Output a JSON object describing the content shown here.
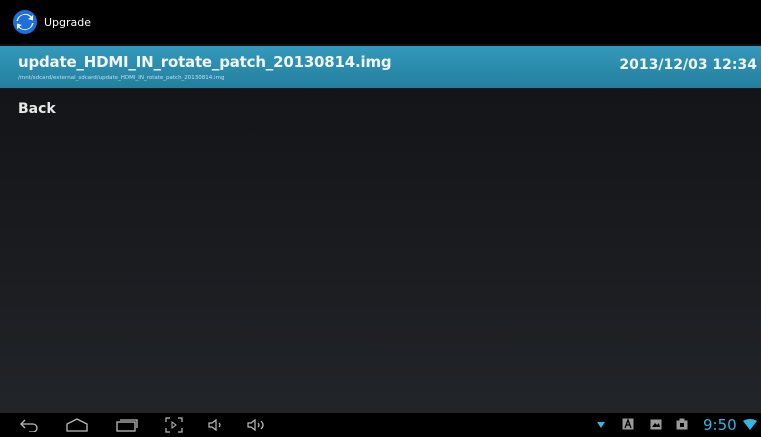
{
  "app": {
    "title": "Upgrade",
    "icon": "upgrade-sync-icon"
  },
  "file_list": {
    "items": [
      {
        "name": "update_HDMI_IN_rotate_patch_20130814.img",
        "path": "/mnt/sdcard/external_sdcard/update_HDMI_IN_rotate_patch_20130814.img",
        "date": "2013/12/03 12:34",
        "selected": true
      }
    ],
    "back_label": "Back"
  },
  "nav_bar": {
    "buttons": [
      "back-icon",
      "home-icon",
      "recent-apps-icon",
      "screenshot-icon",
      "volume-down-icon",
      "volume-up-icon"
    ]
  },
  "status_bar": {
    "icons": [
      "download-icon",
      "keyboard-a-icon",
      "gallery-icon",
      "usb-icon",
      "wifi-icon"
    ],
    "clock": "9:50"
  },
  "colors": {
    "accent": "#33b5e5",
    "selection": "#2a8fb0",
    "background": "#1a1c20"
  }
}
